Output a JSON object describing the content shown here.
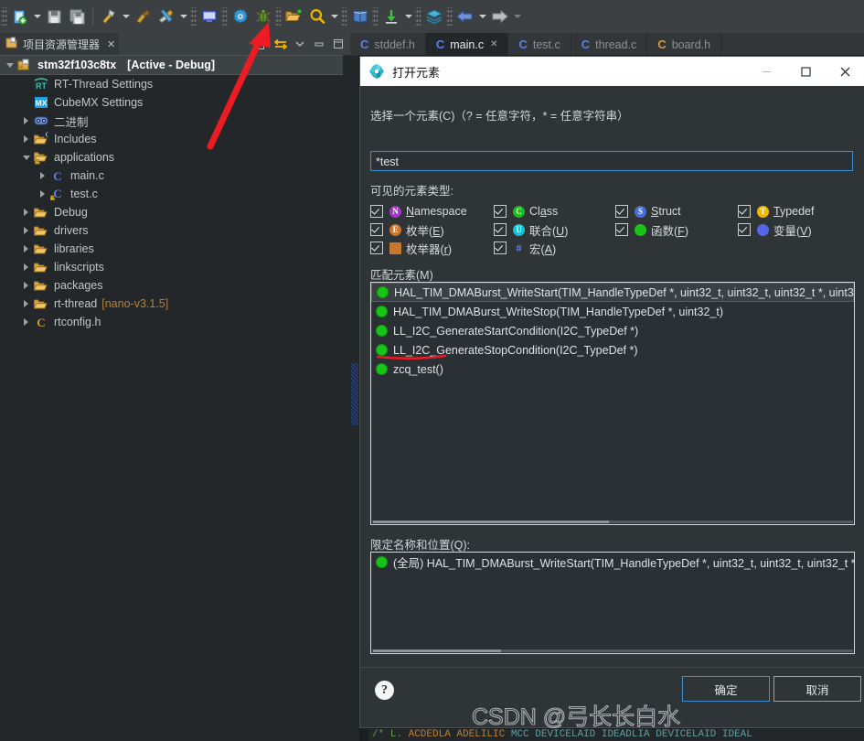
{
  "toolbar": {
    "items": [
      {
        "name": "new-project-icon",
        "glyph": "new"
      },
      {
        "name": "new-dropdown-arrow",
        "glyph": "arrow"
      },
      {
        "name": "save-icon",
        "glyph": "save"
      },
      {
        "name": "save-all-icon",
        "glyph": "saveall"
      },
      {
        "name": "build-icon",
        "glyph": "hammer"
      },
      {
        "name": "build-dropdown-arrow",
        "glyph": "arrow"
      },
      {
        "name": "clean-icon",
        "glyph": "brush"
      },
      {
        "name": "build-config-icon",
        "glyph": "tools"
      },
      {
        "name": "build-config-dropdown-arrow",
        "glyph": "arrow"
      },
      {
        "name": "console-icon",
        "glyph": "monitor"
      },
      {
        "name": "settings-icon",
        "glyph": "gear"
      },
      {
        "name": "debug-icon",
        "glyph": "bug"
      },
      {
        "name": "open-element-icon",
        "glyph": "openfolder"
      },
      {
        "name": "search-icon",
        "glyph": "magnifier"
      },
      {
        "name": "search-dropdown-arrow",
        "glyph": "arrow"
      },
      {
        "name": "book-icon",
        "glyph": "book"
      },
      {
        "name": "download-icon",
        "glyph": "download"
      },
      {
        "name": "download-dropdown-arrow",
        "glyph": "arrow"
      },
      {
        "name": "perspective-icon",
        "glyph": "layers"
      },
      {
        "name": "back-icon",
        "glyph": "left"
      },
      {
        "name": "back-dropdown-arrow",
        "glyph": "arrow"
      },
      {
        "name": "forward-icon",
        "glyph": "right"
      },
      {
        "name": "forward-dropdown-arrow",
        "glyph": "arrow-dim"
      }
    ]
  },
  "explorer": {
    "title": "项目资源管理器",
    "close_label": "✕",
    "tools": [
      "link-with-editor-icon",
      "collapse-all-icon",
      "view-menu-icon",
      "minimize-icon",
      "maximize-icon"
    ],
    "tree": [
      {
        "label": "stm32f103c8tx",
        "suffix": "[Active - Debug]",
        "indent": 0,
        "twisty": "expanded",
        "icon": "project",
        "selected": true
      },
      {
        "label": "RT-Thread Settings",
        "suffix": "",
        "indent": 1,
        "twisty": "none",
        "icon": "rt"
      },
      {
        "label": "CubeMX Settings",
        "suffix": "",
        "indent": 1,
        "twisty": "none",
        "icon": "mx"
      },
      {
        "label": "二进制",
        "suffix": "",
        "indent": 1,
        "twisty": "collapsed",
        "icon": "binary"
      },
      {
        "label": "Includes",
        "suffix": "",
        "indent": 1,
        "twisty": "collapsed",
        "icon": "includes"
      },
      {
        "label": "applications",
        "suffix": "",
        "indent": 1,
        "twisty": "expanded",
        "icon": "folder-warn"
      },
      {
        "label": "main.c",
        "suffix": "",
        "indent": 2,
        "twisty": "collapsed",
        "icon": "cfile"
      },
      {
        "label": "test.c",
        "suffix": "",
        "indent": 2,
        "twisty": "collapsed",
        "icon": "cfile-warn"
      },
      {
        "label": "Debug",
        "suffix": "",
        "indent": 1,
        "twisty": "collapsed",
        "icon": "folder"
      },
      {
        "label": "drivers",
        "suffix": "",
        "indent": 1,
        "twisty": "collapsed",
        "icon": "folder"
      },
      {
        "label": "libraries",
        "suffix": "",
        "indent": 1,
        "twisty": "collapsed",
        "icon": "folder"
      },
      {
        "label": "linkscripts",
        "suffix": "",
        "indent": 1,
        "twisty": "collapsed",
        "icon": "folder"
      },
      {
        "label": "packages",
        "suffix": "",
        "indent": 1,
        "twisty": "collapsed",
        "icon": "folder"
      },
      {
        "label": "rt-thread",
        "suffix": "[nano-v3.1.5]",
        "indent": 1,
        "twisty": "collapsed",
        "icon": "folder"
      },
      {
        "label": "rtconfig.h",
        "suffix": "",
        "indent": 1,
        "twisty": "collapsed",
        "icon": "hfile"
      }
    ]
  },
  "editor": {
    "tabs": [
      {
        "label": "stddef.h",
        "active": false,
        "closeable": false,
        "badge": "C"
      },
      {
        "label": "main.c",
        "active": true,
        "closeable": true,
        "badge": "C"
      },
      {
        "label": "test.c",
        "active": false,
        "closeable": false,
        "badge": "C"
      },
      {
        "label": "thread.c",
        "active": false,
        "closeable": false,
        "badge": "C"
      },
      {
        "label": "board.h",
        "active": false,
        "closeable": false,
        "badge": "C"
      }
    ],
    "bottom_code_sliver": "/*  L. ACDEDLA  ADELILIC    MCC  DEVICELAID      IDEADLIA  DEVICELAID     IDEAL"
  },
  "dialog": {
    "title": "打开元素",
    "window_buttons": {
      "minimize": "—",
      "maximize": "▢",
      "close": "✕"
    },
    "select_label": "选择一个元素(C)（? = 任意字符，* = 任意字符串）",
    "pattern_value": "*test",
    "types_label": "可见的元素类型:",
    "types": [
      {
        "label": "Namespace",
        "accesskey": "N",
        "glyph": "N",
        "color": "#a335c8",
        "underline_index": 0
      },
      {
        "label": "Class",
        "accesskey": "a",
        "glyph": "C",
        "color": "#1fb81f",
        "underline_index": 2
      },
      {
        "label": "Struct",
        "accesskey": "S",
        "glyph": "S",
        "color": "#4a6fd4",
        "underline_index": 0
      },
      {
        "label": "Typedef",
        "accesskey": "T",
        "glyph": "T",
        "color": "#f0b800",
        "underline_index": 0
      },
      {
        "label": "枚举(E)",
        "accesskey": "E",
        "glyph": "E",
        "color": "#c9772e",
        "underline_index": -1
      },
      {
        "label": "联合(U)",
        "accesskey": "U",
        "glyph": "U",
        "color": "#17c4d4",
        "underline_index": -1
      },
      {
        "label": "函数(F)",
        "accesskey": "F",
        "glyph": "",
        "color": "#19c419",
        "underline_index": -1
      },
      {
        "label": "变量(V)",
        "accesskey": "V",
        "glyph": "",
        "color": "#5566e8",
        "underline_index": -1
      },
      {
        "label": "枚举器(r)",
        "accesskey": "r",
        "glyph": "■",
        "color": "#c9772e",
        "underline_index": -1
      },
      {
        "label": "宏(A)",
        "accesskey": "A",
        "glyph": "#",
        "color": "#6f86e8",
        "underline_index": -1
      }
    ],
    "matches_label": "匹配元素(M)",
    "matches": [
      {
        "text": "HAL_TIM_DMABurst_WriteStart(TIM_HandleTypeDef *, uint32_t, uint32_t, uint32_t *, uint3",
        "selected": true
      },
      {
        "text": "HAL_TIM_DMABurst_WriteStop(TIM_HandleTypeDef *, uint32_t)",
        "selected": false
      },
      {
        "text": "LL_I2C_GenerateStartCondition(I2C_TypeDef *)",
        "selected": false
      },
      {
        "text": "LL_I2C_GenerateStopCondition(I2C_TypeDef *)",
        "selected": false
      },
      {
        "text": "zcq_test()",
        "selected": false,
        "annotated": true
      }
    ],
    "qualifier_label": "限定名称和位置(Q):",
    "qualifiers": [
      {
        "text": "(全局) HAL_TIM_DMABurst_WriteStart(TIM_HandleTypeDef *, uint32_t, uint32_t, uint32_t *"
      }
    ],
    "help_label": "?",
    "ok_label": "确定",
    "cancel_label": "取消"
  },
  "annotations": {
    "watermark": "CSDN @弓长长白水",
    "arrow_color": "#ec1c24",
    "underline_color": "#ec1c24"
  }
}
